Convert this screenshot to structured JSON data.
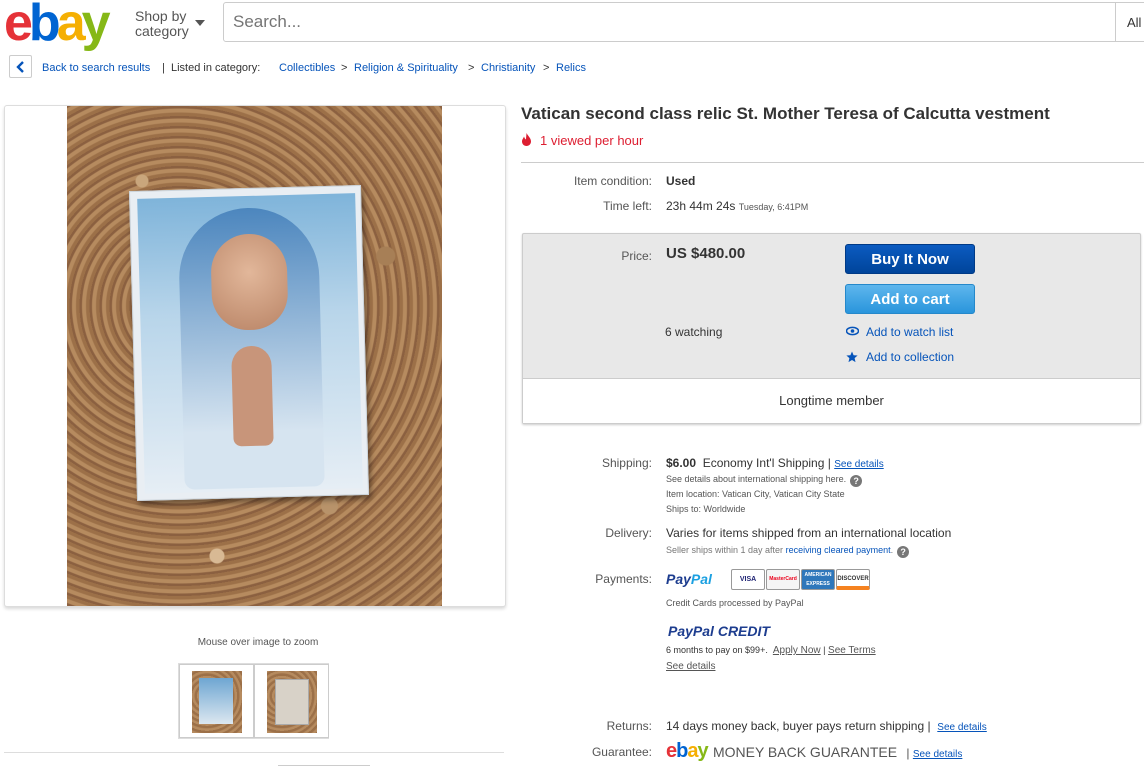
{
  "header": {
    "logo": {
      "e": "e",
      "b": "b",
      "a": "a",
      "y": "y"
    },
    "shop_by_line1": "Shop by",
    "shop_by_line2": "category",
    "search_placeholder": "Search...",
    "all_categories_label": "All"
  },
  "breadcrumb": {
    "back_label": "Back to search results",
    "separator": "|",
    "listed_in": "Listed in category:",
    "items": [
      "Collectibles",
      "Religion & Spirituality",
      "Christianity",
      "Relics"
    ],
    "arrow": ">"
  },
  "gallery": {
    "zoom_hint": "Mouse over image to zoom"
  },
  "listing": {
    "title": "Vatican second class relic St. Mother Teresa of Calcutta vestment",
    "viewed": "1 viewed per hour",
    "condition_label": "Item condition:",
    "condition_value": "Used",
    "time_left_label": "Time left:",
    "time_left_value": "23h 44m 24s",
    "time_left_end": "Tuesday, 6:41PM"
  },
  "purchase": {
    "price_label": "Price:",
    "price_value": "US $480.00",
    "buy_now_label": "Buy It Now",
    "add_to_cart_label": "Add to cart",
    "watching": "6 watching",
    "add_watch_list": "Add to watch list",
    "add_collection": "Add to collection",
    "seller_badge": "Longtime member"
  },
  "shipping": {
    "label": "Shipping:",
    "cost": "$6.00",
    "service": "Economy Int'l Shipping",
    "pipe": "|",
    "see_details": "See details",
    "note": "See details about international shipping here.",
    "qmark": "?",
    "item_location": "Item location:  Vatican City, Vatican City State",
    "ships_to": "Ships to:  Worldwide"
  },
  "delivery": {
    "label": "Delivery:",
    "value": "Varies for items shipped from an international location",
    "note_prefix": "Seller ships within 1 day after",
    "note_link": "receiving cleared payment",
    "note_suffix": ".",
    "qmark": "?"
  },
  "payments": {
    "label": "Payments:",
    "paypal_a": "Pay",
    "paypal_b": "Pal",
    "cards": [
      "VISA",
      "MasterCard",
      "AMERICAN EXPRESS",
      "DISCOVER"
    ],
    "credit_note": "Credit Cards processed by PayPal",
    "credit_brand_a": "PayPal",
    "credit_brand_b": "CREDIT",
    "credit_offer": "6 months to pay on $99+.",
    "apply_now": "Apply Now",
    "pipe": "|",
    "see_terms": "See Terms",
    "see_details": "See details"
  },
  "returns": {
    "label": "Returns:",
    "value": "14 days money back, buyer pays return shipping",
    "pipe": "|",
    "see_details": "See details"
  },
  "guarantee": {
    "label": "Guarantee:",
    "logo": {
      "e": "e",
      "b": "b",
      "a": "a",
      "y": "y"
    },
    "text": "MONEY BACK GUARANTEE",
    "pipe": "|",
    "see_details": "See details"
  },
  "colors": {
    "link": "#0654ba",
    "alert_red": "#dd1e31",
    "buy_button": "#0654ba",
    "cart_button": "#3ca6e6"
  }
}
